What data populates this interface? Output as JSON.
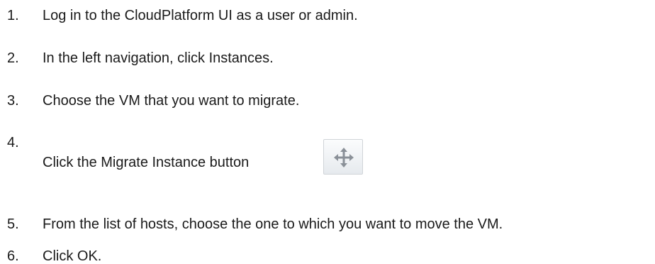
{
  "steps": [
    {
      "number": "1.",
      "text": "Log in to the CloudPlatform UI as a user or admin."
    },
    {
      "number": "2.",
      "text": "In the left navigation, click Instances."
    },
    {
      "number": "3.",
      "text": "Choose the VM that you want to migrate."
    },
    {
      "number": "4.",
      "text": "Click the Migrate Instance button"
    },
    {
      "number": "5.",
      "text": "From the list of hosts, choose the one to which you want to move the VM."
    },
    {
      "number": "6.",
      "text": "Click OK."
    }
  ],
  "icons": {
    "migrate_instance_button": "move-arrows-icon"
  }
}
